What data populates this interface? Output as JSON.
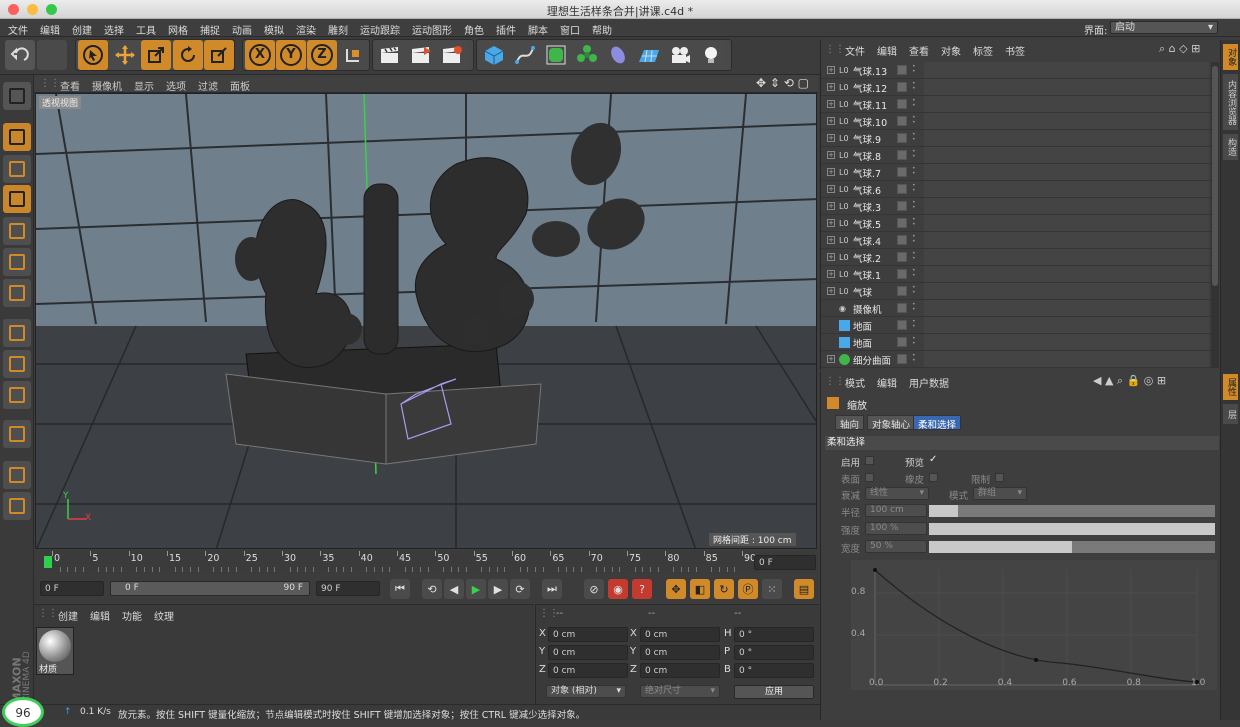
{
  "window": {
    "title": "理想生活样条合并|讲课.c4d *"
  },
  "menu": {
    "items": [
      "文件",
      "编辑",
      "创建",
      "选择",
      "工具",
      "网格",
      "捕捉",
      "动画",
      "模拟",
      "渲染",
      "雕刻",
      "运动跟踪",
      "运动图形",
      "角色",
      "插件",
      "脚本",
      "窗口",
      "帮助"
    ],
    "layout_label": "界面:",
    "layout_value": "启动"
  },
  "toolbar": {
    "axis_x": "X",
    "axis_y": "Y",
    "axis_z": "Z"
  },
  "viewport": {
    "menu": [
      "查看",
      "摄像机",
      "显示",
      "选项",
      "过滤",
      "面板"
    ],
    "view_name": "透视视图",
    "grid_spacing": "网格间距 : 100 cm",
    "axis_x": "X",
    "axis_y": "Y"
  },
  "timeline": {
    "ticks": [
      "0",
      "5",
      "10",
      "15",
      "20",
      "25",
      "30",
      "35",
      "40",
      "45",
      "50",
      "55",
      "60",
      "65",
      "70",
      "75",
      "80",
      "85",
      "90"
    ],
    "current_frame": "0 F",
    "start_field": "0 F",
    "range_start": "0 F",
    "range_end": "90 F",
    "end_field": "90 F"
  },
  "material_manager": {
    "menu": [
      "创建",
      "编辑",
      "功能",
      "纹理"
    ],
    "material_name": "材质"
  },
  "coordinates": {
    "header": [
      "--",
      "--",
      "--"
    ],
    "rows": [
      {
        "a": "X",
        "av": "0 cm",
        "b": "X",
        "bv": "0 cm",
        "c": "H",
        "cv": "0 °"
      },
      {
        "a": "Y",
        "av": "0 cm",
        "b": "Y",
        "bv": "0 cm",
        "c": "P",
        "cv": "0 °"
      },
      {
        "a": "Z",
        "av": "0 cm",
        "b": "Z",
        "bv": "0 cm",
        "c": "B",
        "cv": "0 °"
      }
    ],
    "mode_select": "对象 (相对)",
    "size_select": "绝对尺寸",
    "apply_label": "应用"
  },
  "status": {
    "text": "放元素。按住 SHIFT 键量化缩放；节点编辑模式时按住 SHIFT 键增加选择对象；按住 CTRL 键减少选择对象。",
    "net_speed": "0.1 K/s",
    "badge": "96"
  },
  "brand": {
    "line1": "MAXON",
    "line2": "CINEMA 4D"
  },
  "object_manager": {
    "menu": [
      "文件",
      "编辑",
      "查看",
      "对象",
      "标签",
      "书签"
    ],
    "objects": [
      {
        "name": "气球.13",
        "icon": "null"
      },
      {
        "name": "气球.12",
        "icon": "null"
      },
      {
        "name": "气球.11",
        "icon": "null"
      },
      {
        "name": "气球.10",
        "icon": "null"
      },
      {
        "name": "气球.9",
        "icon": "null"
      },
      {
        "name": "气球.8",
        "icon": "null"
      },
      {
        "name": "气球.7",
        "icon": "null"
      },
      {
        "name": "气球.6",
        "icon": "null"
      },
      {
        "name": "气球.3",
        "icon": "null"
      },
      {
        "name": "气球.5",
        "icon": "null"
      },
      {
        "name": "气球.4",
        "icon": "null"
      },
      {
        "name": "气球.2",
        "icon": "null"
      },
      {
        "name": "气球.1",
        "icon": "null"
      },
      {
        "name": "气球",
        "icon": "null"
      },
      {
        "name": "摄像机",
        "icon": "camera"
      },
      {
        "name": "地面",
        "icon": "floor"
      },
      {
        "name": "地面",
        "icon": "floor"
      },
      {
        "name": "细分曲面",
        "icon": "subdiv"
      }
    ]
  },
  "attribute_manager": {
    "menu": [
      "模式",
      "编辑",
      "用户数据"
    ],
    "object_name": "缩放",
    "tabs": [
      "轴向",
      "对象轴心",
      "柔和选择"
    ],
    "active_tab": 2,
    "section_title": "柔和选择",
    "enable_label": "启用",
    "preview_label": "预览",
    "surface_label": "表面",
    "rubber_label": "橡皮",
    "restrict_label": "限制",
    "falloff_label": "衰减",
    "falloff_value": "线性",
    "mode_label": "模式",
    "mode_value": "群组",
    "radius_label": "半径",
    "radius_value": "100 cm",
    "strength_label": "强度",
    "strength_value": "100 %",
    "width_label": "宽度",
    "width_value": "50 %",
    "width_fraction": 0.5,
    "strength_fraction": 1.0,
    "radius_fraction": 0.1,
    "graph_y_ticks": [
      "0.8",
      "0.4"
    ],
    "graph_x_ticks": [
      "0.0",
      "0.2",
      "0.4",
      "0.6",
      "0.8",
      "1.0"
    ]
  },
  "right_tabs": [
    "对象",
    "内容浏览器",
    "构造",
    "属性",
    "层"
  ]
}
